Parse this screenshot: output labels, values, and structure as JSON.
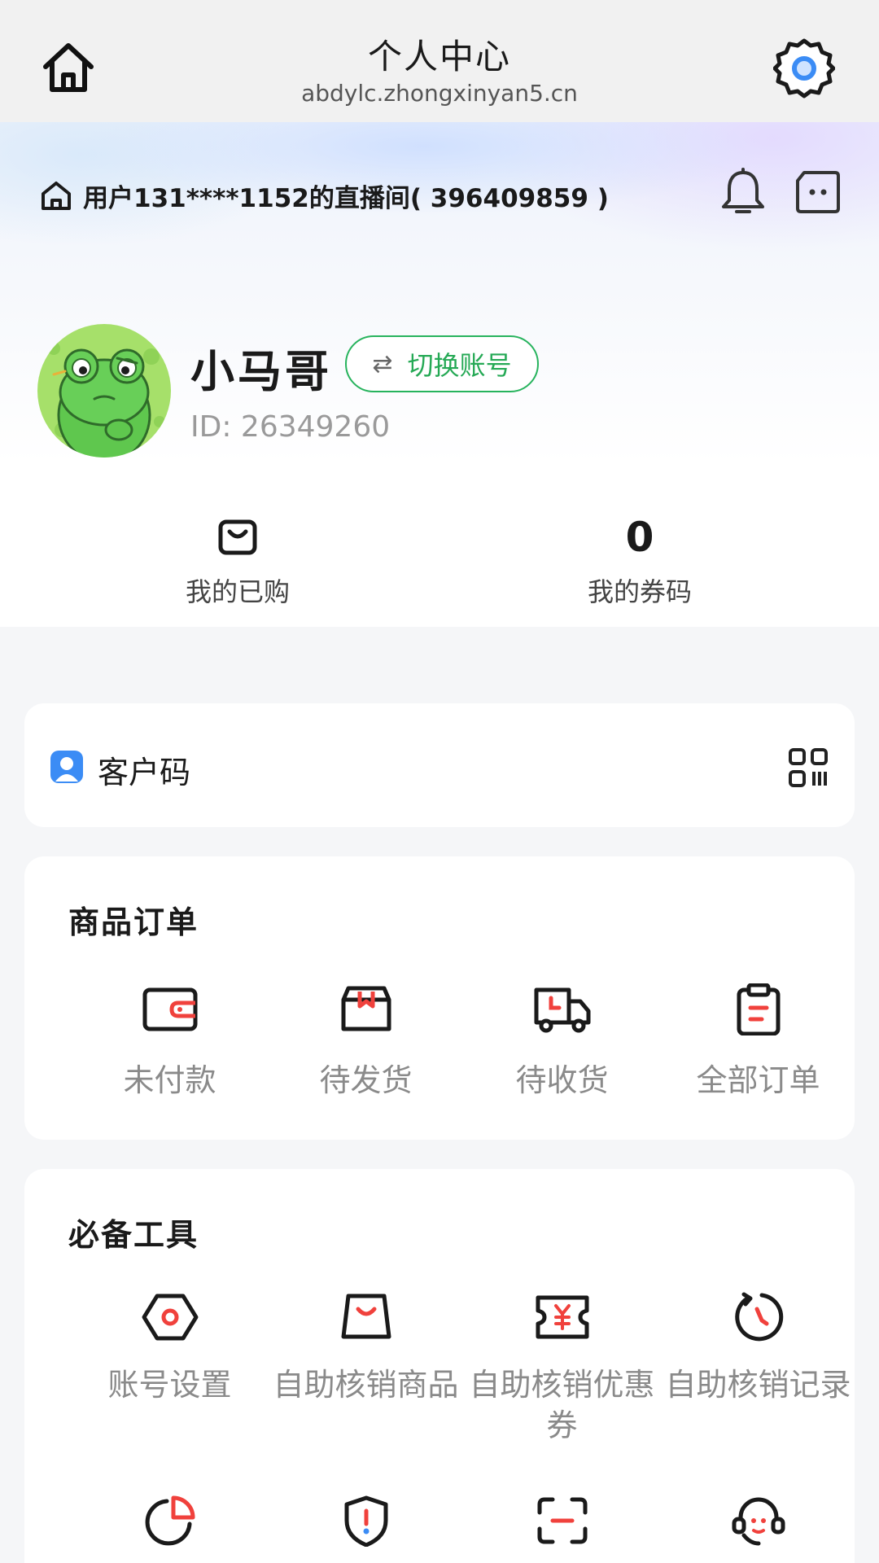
{
  "topbar": {
    "title": "个人中心",
    "subtitle": "abdylc.zhongxinyan5.cn",
    "home_icon": "home-icon",
    "settings_icon": "gear-icon"
  },
  "header": {
    "room_label": "用户131****1152的直播间( 396409859 )",
    "bell_icon": "bell-icon",
    "chat_icon": "chat-icon"
  },
  "profile": {
    "name": "小马哥",
    "switch_label": "切换账号",
    "id_text": "ID: 26349260"
  },
  "stats": {
    "purchased_label": "我的已购",
    "coupons_count": "0",
    "coupons_label": "我的券码"
  },
  "customer": {
    "label": "客户码"
  },
  "orders": {
    "title": "商品订单",
    "items": [
      {
        "label": "未付款",
        "icon": "wallet-icon"
      },
      {
        "label": "待发货",
        "icon": "box-icon"
      },
      {
        "label": "待收货",
        "icon": "truck-icon"
      },
      {
        "label": "全部订单",
        "icon": "clipboard-icon"
      }
    ]
  },
  "tools": {
    "title": "必备工具",
    "items": [
      {
        "label": "账号设置",
        "icon": "hexagon-settings-icon"
      },
      {
        "label": "自助核销商品",
        "icon": "bag-icon"
      },
      {
        "label": "自助核销优惠券",
        "icon": "coupon-icon"
      },
      {
        "label": "自助核销记录",
        "icon": "history-icon"
      },
      {
        "label": "",
        "icon": "pie-chart-icon"
      },
      {
        "label": "",
        "icon": "shield-alert-icon"
      },
      {
        "label": "",
        "icon": "scan-icon"
      },
      {
        "label": "",
        "icon": "customer-service-icon"
      }
    ]
  },
  "colors": {
    "accent_green": "#27b35d",
    "accent_red": "#f0413c",
    "accent_blue": "#3b8cf5"
  }
}
